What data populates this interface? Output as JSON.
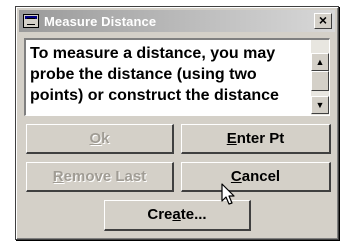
{
  "dialog": {
    "title": "Measure Distance",
    "close_label": "×",
    "message": "To measure a distance, you may probe the distance (using two points) or construct the distance"
  },
  "buttons": {
    "ok": {
      "pre": "",
      "accel": "O",
      "post": "k",
      "enabled": false
    },
    "enter_pt": {
      "pre": "",
      "accel": "E",
      "post": "nter Pt",
      "enabled": true
    },
    "remove_last": {
      "pre": "",
      "accel": "R",
      "post": "emove Last",
      "enabled": false
    },
    "cancel": {
      "pre": "",
      "accel": "C",
      "post": "ancel",
      "enabled": true
    },
    "create": {
      "pre": "Cre",
      "accel": "a",
      "post": "te...",
      "enabled": true
    }
  },
  "scrollbar": {
    "up_icon": "arrow-up-icon",
    "down_icon": "arrow-down-icon"
  },
  "colors": {
    "face": "#d4d0c8",
    "disabled_text": "#a09c94"
  }
}
